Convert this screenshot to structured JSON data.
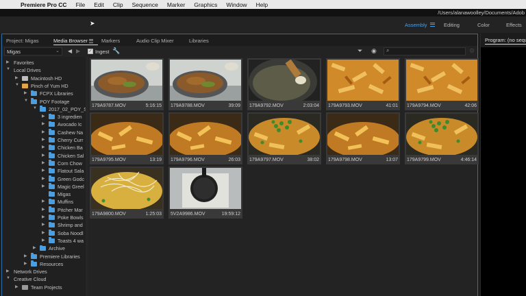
{
  "menubar": {
    "apple": "",
    "app": "Premiere Pro CC",
    "items": [
      "File",
      "Edit",
      "Clip",
      "Sequence",
      "Marker",
      "Graphics",
      "Window",
      "Help"
    ]
  },
  "pathbar": {
    "path": "/Users/alanawoolley/Documents/Adob"
  },
  "workspaces": {
    "tabs": [
      "Assembly",
      "Editing",
      "Color",
      "Effects"
    ],
    "active": "Assembly",
    "accent": "#4aa0e8"
  },
  "panel": {
    "tabs": [
      "Project: Migas",
      "Media Browser",
      "Markers",
      "Audio Clip Mixer",
      "Libraries"
    ],
    "active_tab": "Media Browser"
  },
  "toolbar": {
    "location": "Migas",
    "ingest_label": "Ingest",
    "ingest_checked": true,
    "search_placeholder": ""
  },
  "tree": [
    {
      "label": "Favorites",
      "indent": 0,
      "twisty": "right",
      "icon": "none"
    },
    {
      "label": "Local Drives",
      "indent": 0,
      "twisty": "down",
      "icon": "none"
    },
    {
      "label": "Macintosh HD",
      "indent": 1,
      "twisty": "right",
      "icon": "drive"
    },
    {
      "label": "Pinch of Yum HD",
      "indent": 1,
      "twisty": "down",
      "icon": "drive-orange"
    },
    {
      "label": "FCPX Libraries",
      "indent": 2,
      "twisty": "right",
      "icon": "folder"
    },
    {
      "label": "POY Footage",
      "indent": 2,
      "twisty": "down",
      "icon": "folder"
    },
    {
      "label": "2017_02_POY_S",
      "indent": 3,
      "twisty": "down",
      "icon": "folder"
    },
    {
      "label": "3 ingredien",
      "indent": 4,
      "twisty": "right",
      "icon": "folder"
    },
    {
      "label": "Avocado Ic",
      "indent": 4,
      "twisty": "right",
      "icon": "folder"
    },
    {
      "label": "Cashew Na",
      "indent": 4,
      "twisty": "right",
      "icon": "folder"
    },
    {
      "label": "Cherry Curr",
      "indent": 4,
      "twisty": "right",
      "icon": "folder"
    },
    {
      "label": "Chicken Ba",
      "indent": 4,
      "twisty": "right",
      "icon": "folder"
    },
    {
      "label": "Chicken Sal",
      "indent": 4,
      "twisty": "right",
      "icon": "folder"
    },
    {
      "label": "Corn Chow",
      "indent": 4,
      "twisty": "right",
      "icon": "folder"
    },
    {
      "label": "Flatout Sala",
      "indent": 4,
      "twisty": "right",
      "icon": "folder"
    },
    {
      "label": "Green Godc",
      "indent": 4,
      "twisty": "right",
      "icon": "folder"
    },
    {
      "label": "Magic Greel",
      "indent": 4,
      "twisty": "right",
      "icon": "folder"
    },
    {
      "label": "Migas",
      "indent": 4,
      "twisty": "none",
      "icon": "folder"
    },
    {
      "label": "Muffins",
      "indent": 4,
      "twisty": "right",
      "icon": "folder"
    },
    {
      "label": "Pitcher Mar",
      "indent": 4,
      "twisty": "right",
      "icon": "folder"
    },
    {
      "label": "Poke Bowls",
      "indent": 4,
      "twisty": "right",
      "icon": "folder"
    },
    {
      "label": "Shrimp and",
      "indent": 4,
      "twisty": "right",
      "icon": "folder"
    },
    {
      "label": "Soba Noodl",
      "indent": 4,
      "twisty": "right",
      "icon": "folder"
    },
    {
      "label": "Toasts 4 wa",
      "indent": 4,
      "twisty": "right",
      "icon": "folder"
    },
    {
      "label": "Archive",
      "indent": 3,
      "twisty": "right",
      "icon": "folder"
    },
    {
      "label": "Premiere Libraries",
      "indent": 2,
      "twisty": "right",
      "icon": "folder"
    },
    {
      "label": "Resources",
      "indent": 2,
      "twisty": "right",
      "icon": "folder"
    },
    {
      "label": "Network Drives",
      "indent": 0,
      "twisty": "right",
      "icon": "none"
    },
    {
      "label": "Creative Cloud",
      "indent": 0,
      "twisty": "down",
      "icon": "none"
    },
    {
      "label": "Team Projects",
      "indent": 1,
      "twisty": "right",
      "icon": "drive-gray"
    }
  ],
  "clips": [
    {
      "name": "179A9787.MOV",
      "duration": "5:16:15",
      "scene": "bowl"
    },
    {
      "name": "179A9788.MOV",
      "duration": "39:09",
      "scene": "bowl"
    },
    {
      "name": "179A9792.MOV",
      "duration": "2:03:04",
      "scene": "pan"
    },
    {
      "name": "179A9793.MOV",
      "duration": "41:01",
      "scene": "chips"
    },
    {
      "name": "179A9794.MOV",
      "duration": "42:06",
      "scene": "chips"
    },
    {
      "name": "179A9795.MOV",
      "duration": "13:19",
      "scene": "chips-dark"
    },
    {
      "name": "179A9796.MOV",
      "duration": "26:03",
      "scene": "chips-dark"
    },
    {
      "name": "179A9797.MOV",
      "duration": "38:02",
      "scene": "greens"
    },
    {
      "name": "179A9798.MOV",
      "duration": "13:07",
      "scene": "chips-dark"
    },
    {
      "name": "179A9799.MOV",
      "duration": "4:46:14",
      "scene": "greens"
    },
    {
      "name": "179A9800.MOV",
      "duration": "1:25:03",
      "scene": "cheese"
    },
    {
      "name": "5V2A9986.MOV",
      "duration": "19:59:12",
      "scene": "skillet"
    }
  ],
  "program": {
    "title": "Program: (no seque"
  }
}
